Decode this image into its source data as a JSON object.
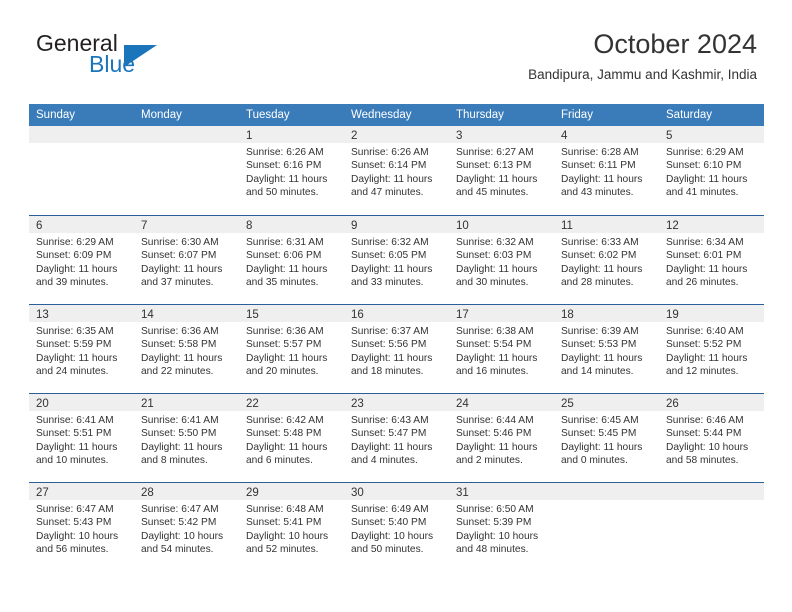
{
  "brand": {
    "name_part1": "General",
    "name_part2": "Blue",
    "triangle_color": "#1b75bb"
  },
  "header": {
    "title": "October 2024",
    "subtitle": "Bandipura, Jammu and Kashmir, India"
  },
  "colors": {
    "header_blue": "#3a7cba",
    "row_divider_blue": "#2a6099",
    "day_band_gray": "#efefef",
    "text": "#333333"
  },
  "weekdays": [
    "Sunday",
    "Monday",
    "Tuesday",
    "Wednesday",
    "Thursday",
    "Friday",
    "Saturday"
  ],
  "weeks": [
    [
      {
        "day": "",
        "sunrise": "",
        "sunset": "",
        "daylight_line1": "",
        "daylight_line2": ""
      },
      {
        "day": "",
        "sunrise": "",
        "sunset": "",
        "daylight_line1": "",
        "daylight_line2": ""
      },
      {
        "day": "1",
        "sunrise": "Sunrise: 6:26 AM",
        "sunset": "Sunset: 6:16 PM",
        "daylight_line1": "Daylight: 11 hours",
        "daylight_line2": "and 50 minutes."
      },
      {
        "day": "2",
        "sunrise": "Sunrise: 6:26 AM",
        "sunset": "Sunset: 6:14 PM",
        "daylight_line1": "Daylight: 11 hours",
        "daylight_line2": "and 47 minutes."
      },
      {
        "day": "3",
        "sunrise": "Sunrise: 6:27 AM",
        "sunset": "Sunset: 6:13 PM",
        "daylight_line1": "Daylight: 11 hours",
        "daylight_line2": "and 45 minutes."
      },
      {
        "day": "4",
        "sunrise": "Sunrise: 6:28 AM",
        "sunset": "Sunset: 6:11 PM",
        "daylight_line1": "Daylight: 11 hours",
        "daylight_line2": "and 43 minutes."
      },
      {
        "day": "5",
        "sunrise": "Sunrise: 6:29 AM",
        "sunset": "Sunset: 6:10 PM",
        "daylight_line1": "Daylight: 11 hours",
        "daylight_line2": "and 41 minutes."
      }
    ],
    [
      {
        "day": "6",
        "sunrise": "Sunrise: 6:29 AM",
        "sunset": "Sunset: 6:09 PM",
        "daylight_line1": "Daylight: 11 hours",
        "daylight_line2": "and 39 minutes."
      },
      {
        "day": "7",
        "sunrise": "Sunrise: 6:30 AM",
        "sunset": "Sunset: 6:07 PM",
        "daylight_line1": "Daylight: 11 hours",
        "daylight_line2": "and 37 minutes."
      },
      {
        "day": "8",
        "sunrise": "Sunrise: 6:31 AM",
        "sunset": "Sunset: 6:06 PM",
        "daylight_line1": "Daylight: 11 hours",
        "daylight_line2": "and 35 minutes."
      },
      {
        "day": "9",
        "sunrise": "Sunrise: 6:32 AM",
        "sunset": "Sunset: 6:05 PM",
        "daylight_line1": "Daylight: 11 hours",
        "daylight_line2": "and 33 minutes."
      },
      {
        "day": "10",
        "sunrise": "Sunrise: 6:32 AM",
        "sunset": "Sunset: 6:03 PM",
        "daylight_line1": "Daylight: 11 hours",
        "daylight_line2": "and 30 minutes."
      },
      {
        "day": "11",
        "sunrise": "Sunrise: 6:33 AM",
        "sunset": "Sunset: 6:02 PM",
        "daylight_line1": "Daylight: 11 hours",
        "daylight_line2": "and 28 minutes."
      },
      {
        "day": "12",
        "sunrise": "Sunrise: 6:34 AM",
        "sunset": "Sunset: 6:01 PM",
        "daylight_line1": "Daylight: 11 hours",
        "daylight_line2": "and 26 minutes."
      }
    ],
    [
      {
        "day": "13",
        "sunrise": "Sunrise: 6:35 AM",
        "sunset": "Sunset: 5:59 PM",
        "daylight_line1": "Daylight: 11 hours",
        "daylight_line2": "and 24 minutes."
      },
      {
        "day": "14",
        "sunrise": "Sunrise: 6:36 AM",
        "sunset": "Sunset: 5:58 PM",
        "daylight_line1": "Daylight: 11 hours",
        "daylight_line2": "and 22 minutes."
      },
      {
        "day": "15",
        "sunrise": "Sunrise: 6:36 AM",
        "sunset": "Sunset: 5:57 PM",
        "daylight_line1": "Daylight: 11 hours",
        "daylight_line2": "and 20 minutes."
      },
      {
        "day": "16",
        "sunrise": "Sunrise: 6:37 AM",
        "sunset": "Sunset: 5:56 PM",
        "daylight_line1": "Daylight: 11 hours",
        "daylight_line2": "and 18 minutes."
      },
      {
        "day": "17",
        "sunrise": "Sunrise: 6:38 AM",
        "sunset": "Sunset: 5:54 PM",
        "daylight_line1": "Daylight: 11 hours",
        "daylight_line2": "and 16 minutes."
      },
      {
        "day": "18",
        "sunrise": "Sunrise: 6:39 AM",
        "sunset": "Sunset: 5:53 PM",
        "daylight_line1": "Daylight: 11 hours",
        "daylight_line2": "and 14 minutes."
      },
      {
        "day": "19",
        "sunrise": "Sunrise: 6:40 AM",
        "sunset": "Sunset: 5:52 PM",
        "daylight_line1": "Daylight: 11 hours",
        "daylight_line2": "and 12 minutes."
      }
    ],
    [
      {
        "day": "20",
        "sunrise": "Sunrise: 6:41 AM",
        "sunset": "Sunset: 5:51 PM",
        "daylight_line1": "Daylight: 11 hours",
        "daylight_line2": "and 10 minutes."
      },
      {
        "day": "21",
        "sunrise": "Sunrise: 6:41 AM",
        "sunset": "Sunset: 5:50 PM",
        "daylight_line1": "Daylight: 11 hours",
        "daylight_line2": "and 8 minutes."
      },
      {
        "day": "22",
        "sunrise": "Sunrise: 6:42 AM",
        "sunset": "Sunset: 5:48 PM",
        "daylight_line1": "Daylight: 11 hours",
        "daylight_line2": "and 6 minutes."
      },
      {
        "day": "23",
        "sunrise": "Sunrise: 6:43 AM",
        "sunset": "Sunset: 5:47 PM",
        "daylight_line1": "Daylight: 11 hours",
        "daylight_line2": "and 4 minutes."
      },
      {
        "day": "24",
        "sunrise": "Sunrise: 6:44 AM",
        "sunset": "Sunset: 5:46 PM",
        "daylight_line1": "Daylight: 11 hours",
        "daylight_line2": "and 2 minutes."
      },
      {
        "day": "25",
        "sunrise": "Sunrise: 6:45 AM",
        "sunset": "Sunset: 5:45 PM",
        "daylight_line1": "Daylight: 11 hours",
        "daylight_line2": "and 0 minutes."
      },
      {
        "day": "26",
        "sunrise": "Sunrise: 6:46 AM",
        "sunset": "Sunset: 5:44 PM",
        "daylight_line1": "Daylight: 10 hours",
        "daylight_line2": "and 58 minutes."
      }
    ],
    [
      {
        "day": "27",
        "sunrise": "Sunrise: 6:47 AM",
        "sunset": "Sunset: 5:43 PM",
        "daylight_line1": "Daylight: 10 hours",
        "daylight_line2": "and 56 minutes."
      },
      {
        "day": "28",
        "sunrise": "Sunrise: 6:47 AM",
        "sunset": "Sunset: 5:42 PM",
        "daylight_line1": "Daylight: 10 hours",
        "daylight_line2": "and 54 minutes."
      },
      {
        "day": "29",
        "sunrise": "Sunrise: 6:48 AM",
        "sunset": "Sunset: 5:41 PM",
        "daylight_line1": "Daylight: 10 hours",
        "daylight_line2": "and 52 minutes."
      },
      {
        "day": "30",
        "sunrise": "Sunrise: 6:49 AM",
        "sunset": "Sunset: 5:40 PM",
        "daylight_line1": "Daylight: 10 hours",
        "daylight_line2": "and 50 minutes."
      },
      {
        "day": "31",
        "sunrise": "Sunrise: 6:50 AM",
        "sunset": "Sunset: 5:39 PM",
        "daylight_line1": "Daylight: 10 hours",
        "daylight_line2": "and 48 minutes."
      },
      {
        "day": "",
        "sunrise": "",
        "sunset": "",
        "daylight_line1": "",
        "daylight_line2": ""
      },
      {
        "day": "",
        "sunrise": "",
        "sunset": "",
        "daylight_line1": "",
        "daylight_line2": ""
      }
    ]
  ]
}
